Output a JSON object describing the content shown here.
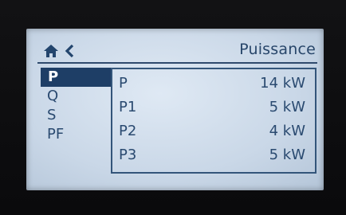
{
  "header": {
    "title": "Puissance",
    "home_icon": "home-icon",
    "back_icon": "chevron-left-icon"
  },
  "menu": {
    "items": [
      {
        "label": "P",
        "selected": true
      },
      {
        "label": "Q",
        "selected": false
      },
      {
        "label": "S",
        "selected": false
      },
      {
        "label": "PF",
        "selected": false
      }
    ]
  },
  "panel": {
    "rows": [
      {
        "label": "P",
        "value": "14 kW"
      },
      {
        "label": "P1",
        "value": "5 kW"
      },
      {
        "label": "P2",
        "value": "4 kW"
      },
      {
        "label": "P3",
        "value": "5 kW"
      }
    ]
  },
  "colors": {
    "lcd_background": "#d4e0ed",
    "text": "#2a4a70",
    "highlight": "#1e3e66"
  }
}
